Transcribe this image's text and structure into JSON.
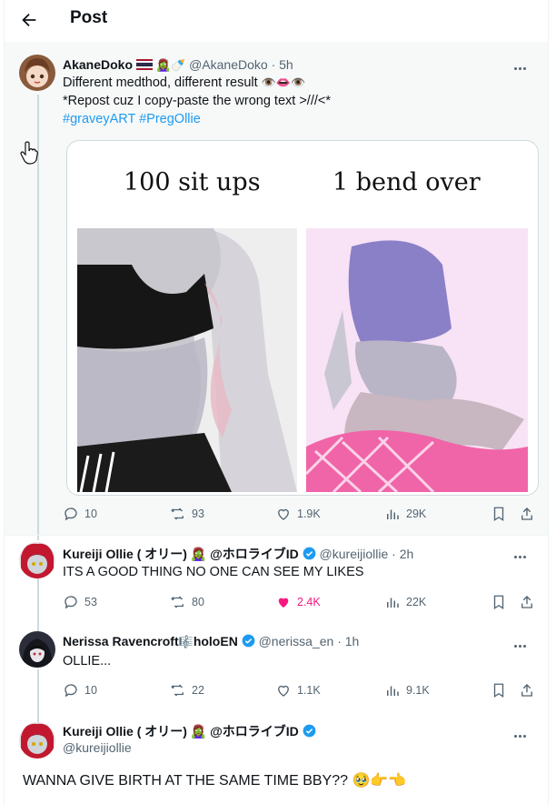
{
  "header": {
    "title": "Post",
    "back_icon": "arrow-left-icon"
  },
  "main_post": {
    "author": "AkaneDoko",
    "handle": "@AkaneDoko",
    "time": "5h",
    "line1": "Different medthod, different result",
    "line1_emoji": "👁️👄👁️",
    "line2": "*Repost cuz I copy-paste the wrong text >///<*",
    "hashtags": [
      "#graveyART",
      "#PregOllie"
    ],
    "image": {
      "left_caption": "100 sit ups",
      "right_caption": "1 bend over"
    },
    "stats": {
      "replies": "10",
      "reposts": "93",
      "likes": "1.9K",
      "views": "29K"
    }
  },
  "replies": [
    {
      "author": "Kureiji Ollie ( オリー) 🧟‍♀️ @ホロライブID",
      "handle": "@kureijiollie",
      "time": "2h",
      "text": "ITS A GOOD THING NO ONE CAN SEE MY LIKES",
      "stats": {
        "replies": "53",
        "reposts": "80",
        "likes": "2.4K",
        "views": "22K"
      },
      "liked": true
    },
    {
      "author": "Nerissa Ravencroft",
      "author_suffix": "holoEN",
      "handle": "@nerissa_en",
      "time": "1h",
      "text": "OLLIE...",
      "stats": {
        "replies": "10",
        "reposts": "22",
        "likes": "1.1K",
        "views": "9.1K"
      },
      "liked": false
    }
  ],
  "focused_reply": {
    "author": "Kureiji Ollie ( オリー) 🧟‍♀️ @ホロライブID",
    "handle": "@kureijiollie",
    "text": "WANNA GIVE BIRTH AT THE SAME TIME BBY??",
    "emoji": "🥹👉👈"
  },
  "colors": {
    "accent": "#1d9bf0",
    "like": "#f91880",
    "muted": "#536471"
  }
}
